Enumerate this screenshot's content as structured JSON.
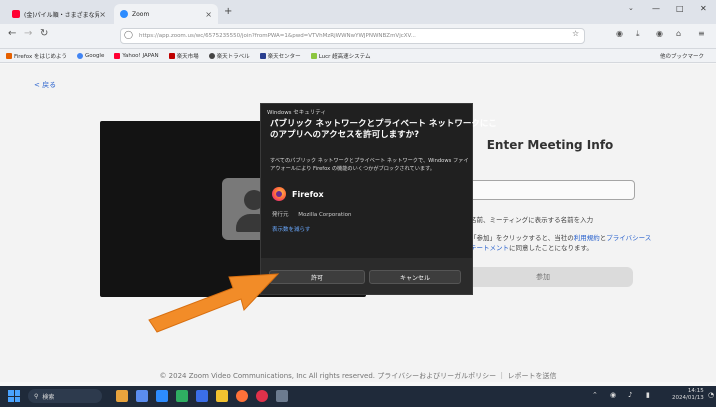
{
  "browser": {
    "tabs": [
      {
        "label": "(金)パイル順・さまざまな見事 - Yahoo!",
        "active": false
      },
      {
        "label": "Zoom",
        "active": true
      }
    ],
    "new_tab_label": "+",
    "url": "https://app.zoom.us/wc/6575235550/join?fromPWA=1&pwd=VTVhMzRjWWNwYWJPNWNBZmVjcXV...",
    "bookmarks": [
      "Firefox をはじめよう",
      "Google",
      "Yahoo! JAPAN",
      "楽天市場",
      "楽天トラベル",
      "楽天センター",
      "Lucr 超高速システム"
    ],
    "bookmark_other": "他のブックマーク",
    "window_controls": [
      "—",
      "□",
      "✕"
    ]
  },
  "page": {
    "back_label": "< 戻る",
    "meeting_title": "Enter Meeting Info",
    "name_hint": "名前、ミーティングに表示する名前を入力",
    "terms_line1_a": "「参加」をクリックすると、当社の",
    "terms_link1": "利用規約",
    "terms_line1_b": "と",
    "terms_link2": "プライバシース",
    "terms_line2_link": "テートメント",
    "terms_line2_b": "に同意したことになります。",
    "join_label": "参加",
    "footer": "© 2024 Zoom Video Communications, Inc All rights reserved. プライバシーおよびリーガルポリシー ｜ レポートを送信"
  },
  "dialog": {
    "header": "Windows セキュリティ",
    "title_line1": "パブリック ネットワークとプライベート ネットワークにこ",
    "title_line2": "のアプリへのアクセスを許可しますか?",
    "body_line1": "すべてのパブリック ネットワークとプライベート ネットワークで、Windows ファイ",
    "body_line2": "アウォールにより Firefox の機能のいくつかがブロックされています。",
    "app_name": "Firefox",
    "publisher_label": "発行元",
    "publisher_value": "Mozilla Corporation",
    "details_link": "表示数を減らす",
    "allow_label": "許可",
    "cancel_label": "キャンセル"
  },
  "taskbar": {
    "search_label": "検索",
    "time": "14:15",
    "date": "2024/01/13"
  },
  "colors": {
    "arrow": "#f28c28",
    "accent": "#2a64d2"
  }
}
